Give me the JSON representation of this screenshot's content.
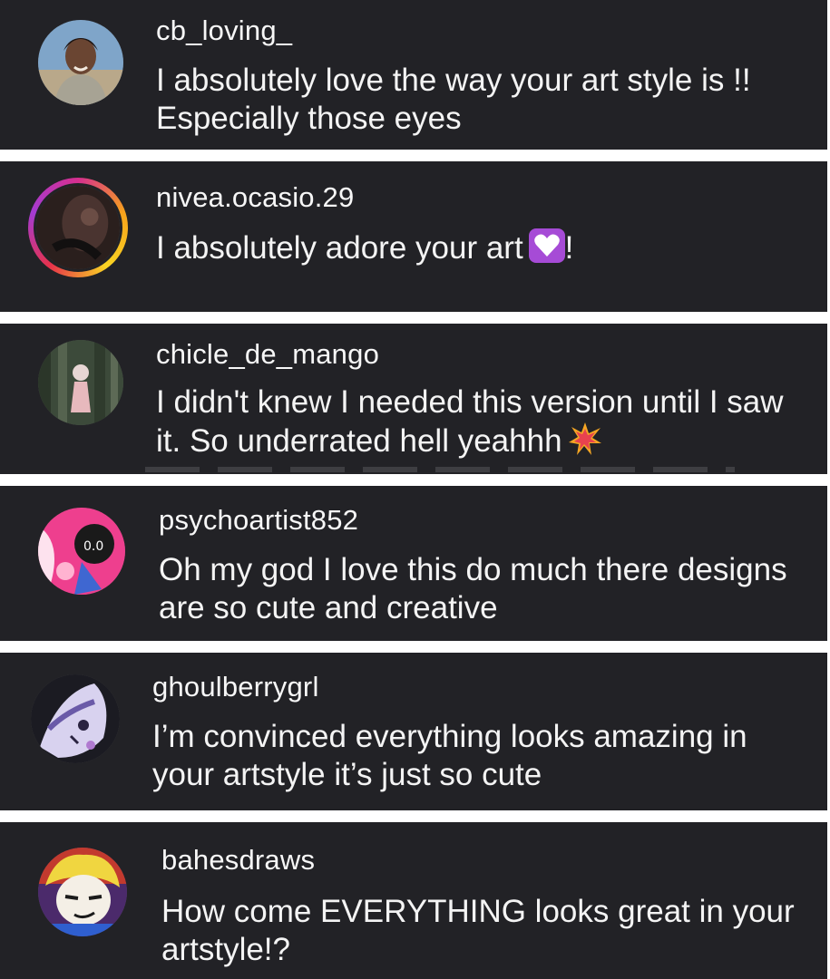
{
  "comments": [
    {
      "username": "cb_loving_",
      "text": "I absolutely love the way your art style is !! Especially those eyes"
    },
    {
      "username": "nivea.ocasio.29",
      "text": "I absolutely adore your art",
      "suffix": "!",
      "emoji": "white-heart-emoji"
    },
    {
      "username": "chicle_de_mango",
      "text": "I didn't knew I needed this version until I saw it. So underrated hell yeahhh",
      "emoji": "collision-emoji"
    },
    {
      "username": "psychoartist852",
      "text": "Oh my god I love this do much there designs are so cute and creative"
    },
    {
      "username": "ghoulberrygrl",
      "text": "I’m convinced everything looks amazing in your artstyle it’s just so cute"
    },
    {
      "username": "bahesdraws",
      "text": "How come EVERYTHING looks great in your artstyle!?"
    }
  ],
  "colors": {
    "card_bg": "#222226",
    "text": "#f4f4f4",
    "separator": "#ffffff"
  }
}
